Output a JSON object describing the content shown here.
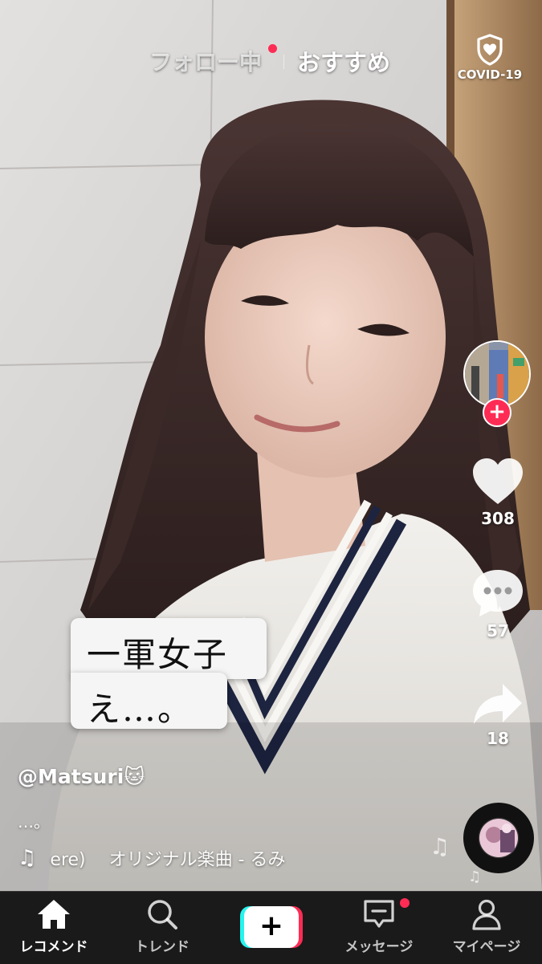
{
  "header": {
    "tab_following": "フォロー中",
    "tab_for_you": "おすすめ",
    "covid_label": "COVID-19"
  },
  "actions": {
    "likes": "308",
    "comments": "57",
    "shares": "18"
  },
  "caption": {
    "line1": "一軍女子",
    "line2": "え…。"
  },
  "post": {
    "username": "@Matsuri🐱",
    "description": "…。",
    "music": "ere)　 オリジナル楽曲 - るみ"
  },
  "nav": {
    "home": "レコメンド",
    "discover": "トレンド",
    "inbox": "メッセージ",
    "profile": "マイページ"
  },
  "icons": {
    "covid": "shield-heart-icon",
    "like": "heart-icon",
    "comment": "comment-bubble-icon",
    "share": "share-arrow-icon",
    "music": "music-note-icon",
    "home": "home-icon",
    "discover": "search-icon",
    "create": "plus-icon",
    "inbox": "message-icon",
    "profile": "person-icon"
  },
  "colors": {
    "accent_red": "#fe2c55",
    "accent_cyan": "#25f4ee",
    "notification_dot": "#fe2c55"
  }
}
